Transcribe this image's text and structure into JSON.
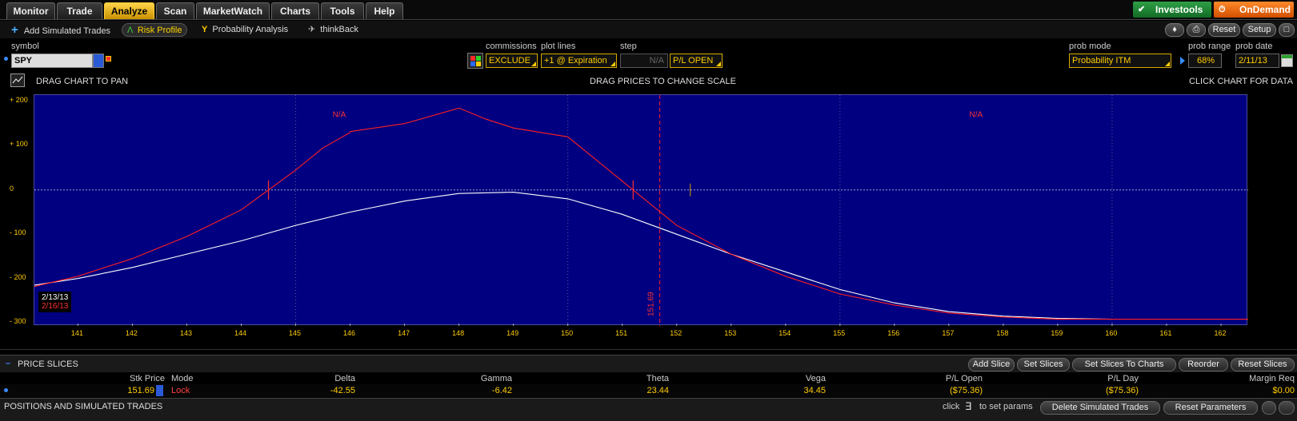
{
  "tabs": [
    {
      "label": "Monitor",
      "active": false
    },
    {
      "label": "Trade",
      "active": false
    },
    {
      "label": "Analyze",
      "active": true
    },
    {
      "label": "Scan",
      "active": false
    },
    {
      "label": "MarketWatch",
      "active": false
    },
    {
      "label": "Charts",
      "active": false
    },
    {
      "label": "Tools",
      "active": false
    },
    {
      "label": "Help",
      "active": false
    }
  ],
  "brand": {
    "investools": "Investools",
    "ondemand": "OnDemand"
  },
  "subnav": {
    "add_simulated": "Add Simulated Trades",
    "risk_profile": "Risk Profile",
    "probability": "Probability Analysis",
    "thinkback": "thinkBack",
    "reset": "Reset",
    "setup": "Setup"
  },
  "controls": {
    "symbol_label": "symbol",
    "symbol_value": "SPY",
    "commissions_label": "commissions",
    "commissions_value": "EXCLUDE",
    "plot_lines_label": "plot lines",
    "plot_lines_value": "+1 @ Expiration",
    "step_label": "step",
    "step_value": "N/A",
    "pl_value": "P/L OPEN",
    "prob_mode_label": "prob mode",
    "prob_mode_value": "Probability ITM",
    "prob_range_label": "prob range",
    "prob_range_value": "68%",
    "prob_date_label": "prob date",
    "prob_date_value": "2/11/13"
  },
  "hints": {
    "pan": "DRAG CHART TO PAN",
    "scale": "DRAG PRICES TO CHANGE SCALE",
    "click": "CLICK CHART FOR DATA"
  },
  "chart_data": {
    "type": "line",
    "xlim": [
      140.2,
      162.5
    ],
    "ylim": [
      -300,
      200
    ],
    "x_ticks": [
      141,
      142,
      143,
      144,
      145,
      146,
      147,
      148,
      149,
      150,
      151,
      152,
      153,
      154,
      155,
      156,
      157,
      158,
      159,
      160,
      161,
      162
    ],
    "y_ticks": [
      {
        "value": 200,
        "label": "+ 200"
      },
      {
        "value": 100,
        "label": "+ 100"
      },
      {
        "value": 0,
        "label": "0"
      },
      {
        "value": -100,
        "label": "- 100"
      },
      {
        "value": -200,
        "label": "- 200"
      },
      {
        "value": -300,
        "label": "- 300"
      }
    ],
    "series": [
      {
        "name": "2/13/13",
        "color": "#ffffff",
        "x": [
          140.2,
          141,
          142,
          143,
          144,
          145,
          146,
          147,
          148,
          149,
          150,
          151,
          152,
          153,
          154,
          155,
          156,
          157,
          158,
          159,
          160
        ],
        "y": [
          -215,
          -200,
          -175,
          -145,
          -115,
          -80,
          -50,
          -25,
          -8,
          -5,
          -20,
          -55,
          -100,
          -145,
          -185,
          -225,
          -255,
          -275,
          -285,
          -290,
          -292
        ]
      },
      {
        "name": "2/16/13",
        "color": "#ff2020",
        "x": [
          140.2,
          141,
          142,
          143,
          144,
          144.5,
          145,
          145.5,
          146,
          146,
          147,
          148,
          148.5,
          149,
          150,
          151,
          151.2,
          152,
          153,
          154,
          155,
          156,
          157,
          158,
          159,
          159.5,
          162.5
        ],
        "y": [
          -218,
          -195,
          -155,
          -105,
          -45,
          0,
          45,
          95,
          130,
          132,
          150,
          185,
          160,
          140,
          120,
          20,
          0,
          -80,
          -145,
          -195,
          -235,
          -260,
          -278,
          -287,
          -292,
          -292,
          -292
        ]
      }
    ],
    "annotations": [
      {
        "text": "N/A",
        "x": 145.8,
        "y": 165
      },
      {
        "text": "N/A",
        "x": 157.5,
        "y": 165
      }
    ],
    "breakeven_marks": [
      144.5,
      151.2
    ],
    "current_price": 151.69,
    "current_price_label": "151.69",
    "prob_mark": 152.25
  },
  "slices": {
    "title": "PRICE SLICES",
    "buttons": [
      "Add Slice",
      "Set Slices",
      "Set Slices To Charts",
      "Reorder",
      "Reset Slices"
    ],
    "columns": [
      "Stk Price",
      "Mode",
      "Delta",
      "Gamma",
      "Theta",
      "Vega",
      "P/L Open",
      "P/L Day",
      "Margin Req"
    ],
    "row": {
      "stk_price": "151.69",
      "mode": "Lock",
      "delta": "-42.55",
      "gamma": "-6.42",
      "theta": "23.44",
      "vega": "34.45",
      "pl_open": "($75.36)",
      "pl_day": "($75.36)",
      "margin": "$0.00"
    }
  },
  "positions": {
    "title": "POSITIONS AND SIMULATED TRADES",
    "click_hint": "click",
    "set_params": "to set params",
    "delete_btn": "Delete Simulated Trades",
    "reset_btn": "Reset Parameters"
  }
}
